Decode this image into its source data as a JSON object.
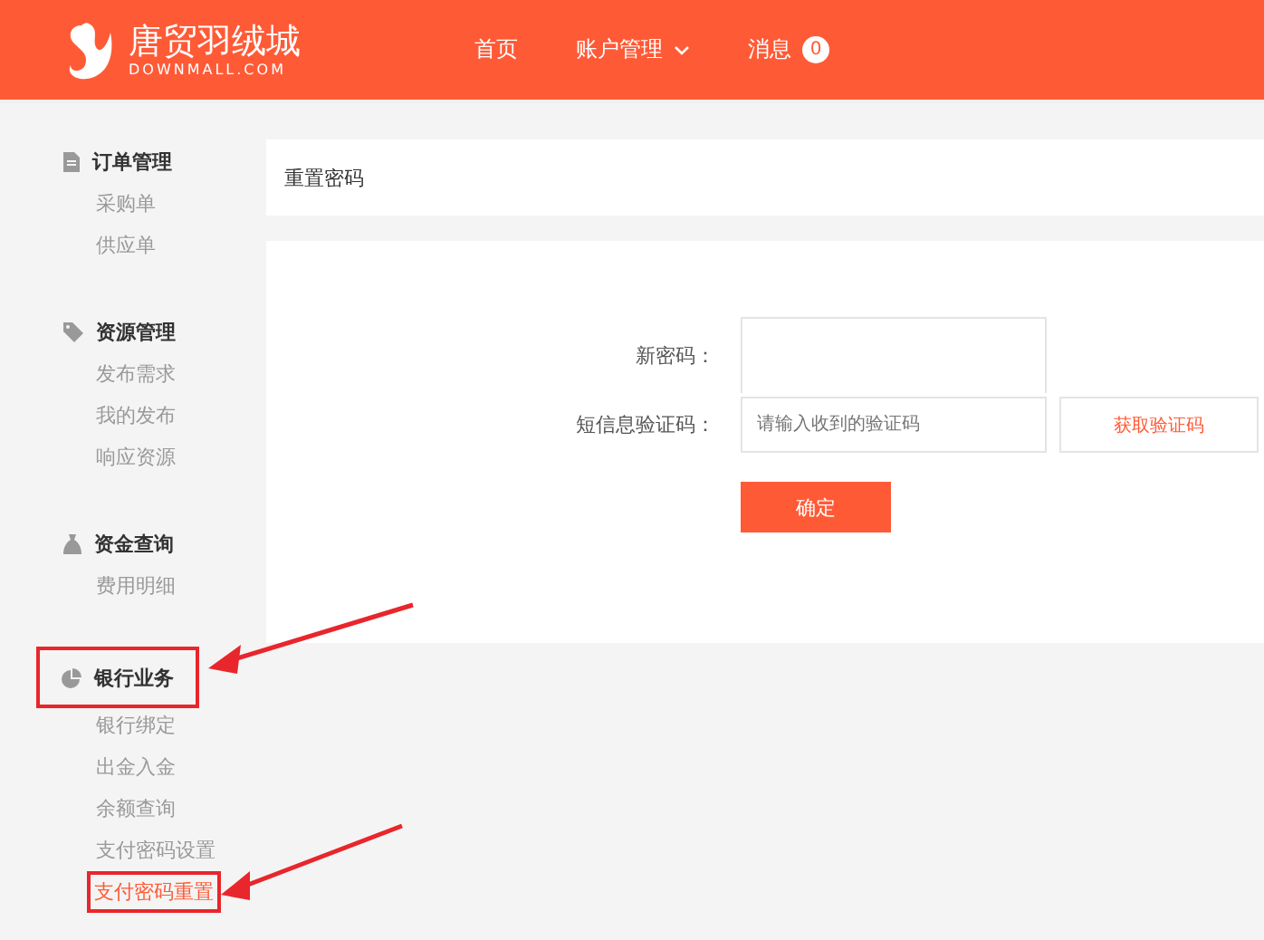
{
  "header": {
    "logo_name": "唐贸羽绒城",
    "logo_domain": "DOWNMALL.COM",
    "nav": [
      {
        "label": "首页",
        "dropdown": false
      },
      {
        "label": "账户管理",
        "dropdown": true
      },
      {
        "label": "消息",
        "badge": "0",
        "dropdown": false
      }
    ]
  },
  "sidebar": {
    "sections": [
      {
        "kind": "orders",
        "title": "订单管理",
        "highlighted": false,
        "items": [
          {
            "label": "采购单",
            "selected": false,
            "highlighted": false
          },
          {
            "label": "供应单",
            "selected": false,
            "highlighted": false
          }
        ]
      },
      {
        "kind": "resources",
        "title": "资源管理",
        "highlighted": false,
        "items": [
          {
            "label": "发布需求",
            "selected": false,
            "highlighted": false
          },
          {
            "label": "我的发布",
            "selected": false,
            "highlighted": false
          },
          {
            "label": "响应资源",
            "selected": false,
            "highlighted": false
          }
        ]
      },
      {
        "kind": "funds",
        "title": "资金查询",
        "highlighted": false,
        "items": [
          {
            "label": "费用明细",
            "selected": false,
            "highlighted": false
          }
        ]
      },
      {
        "kind": "bank",
        "title": "银行业务",
        "highlighted": true,
        "items": [
          {
            "label": "银行绑定",
            "selected": false,
            "highlighted": false
          },
          {
            "label": "出金入金",
            "selected": false,
            "highlighted": false
          },
          {
            "label": "余额查询",
            "selected": false,
            "highlighted": false
          },
          {
            "label": "支付密码设置",
            "selected": false,
            "highlighted": false
          },
          {
            "label": "支付密码重置",
            "selected": true,
            "highlighted": true
          }
        ]
      }
    ]
  },
  "breadcrumb": "重置密码",
  "form": {
    "new_password_label": "新密码：",
    "code_label": "短信息验证码：",
    "code_placeholder": "请输入收到的验证码",
    "get_code_button": "获取验证码",
    "confirm_button": "确定"
  }
}
